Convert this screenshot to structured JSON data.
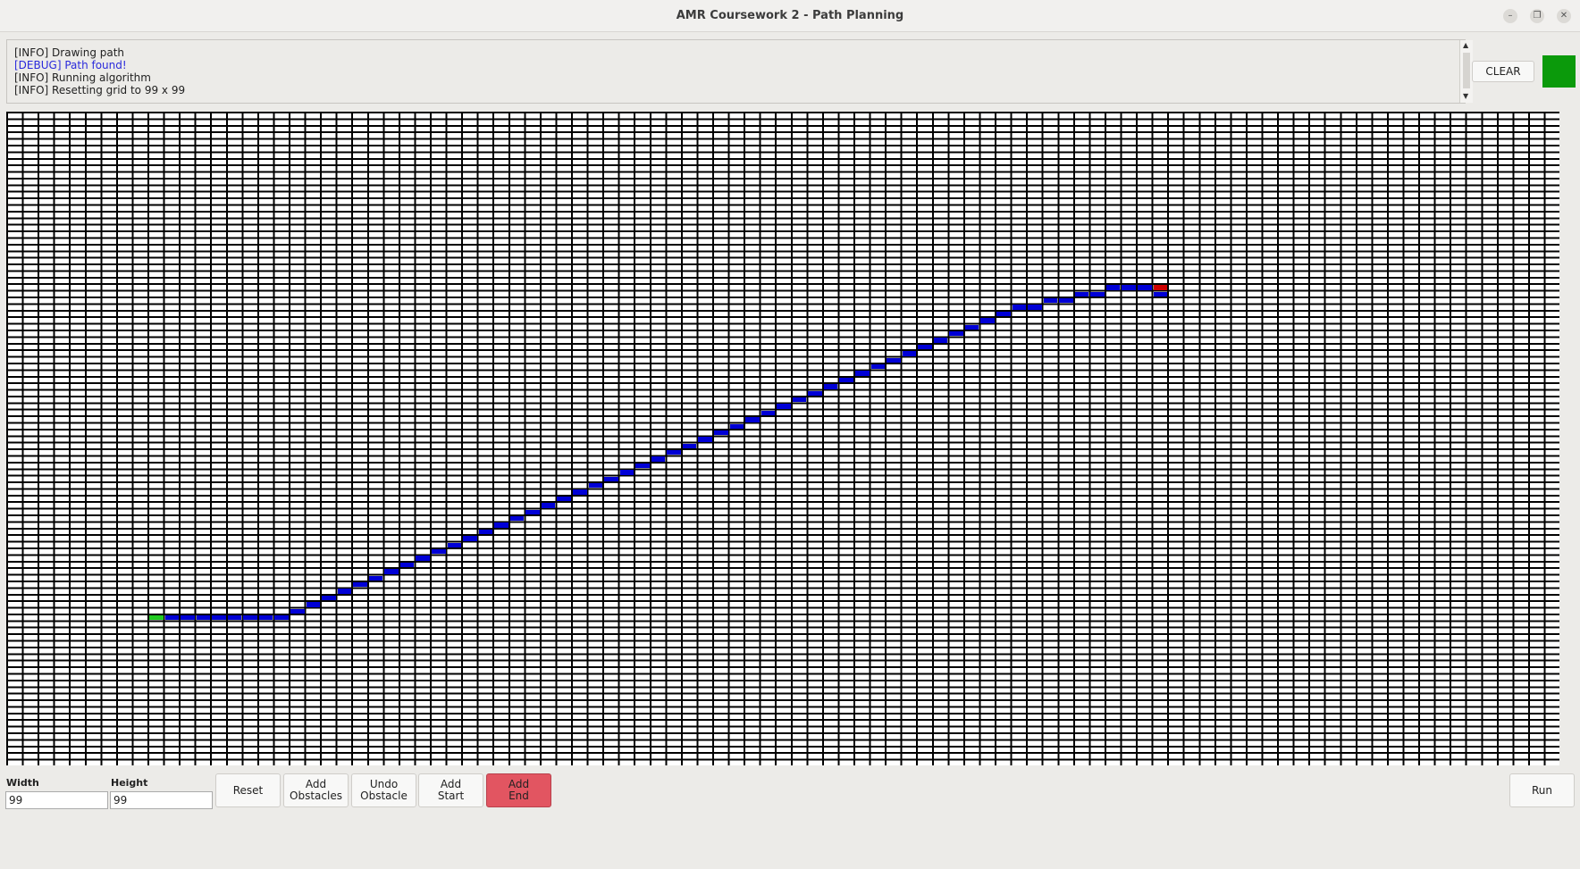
{
  "window": {
    "title": "AMR Coursework 2 - Path Planning",
    "controls": [
      {
        "name": "minimize-icon",
        "glyph": "–"
      },
      {
        "name": "maximize-icon",
        "glyph": "❐"
      },
      {
        "name": "close-icon",
        "glyph": "✕"
      }
    ]
  },
  "log": {
    "lines": [
      {
        "text": "[INFO] Drawing path",
        "level": "info"
      },
      {
        "text": "[DEBUG] Path found!",
        "level": "debug"
      },
      {
        "text": "[INFO] Running algorithm",
        "level": "info"
      },
      {
        "text": "[INFO] Resetting grid to 99 x 99",
        "level": "info"
      }
    ]
  },
  "toolbar_top": {
    "clear_label": "CLEAR",
    "status_color": "#0b9a0b"
  },
  "grid": {
    "columns": 99,
    "rows": 99,
    "colors": {
      "path": "#0000d6",
      "start": "#22cc22",
      "end": "#cc0000",
      "line": "#000000",
      "empty": "#ffffff"
    },
    "start": {
      "col": 9,
      "row": 76
    },
    "end": {
      "col": 73,
      "row": 26
    },
    "path": [
      [
        10,
        76
      ],
      [
        11,
        76
      ],
      [
        12,
        76
      ],
      [
        13,
        76
      ],
      [
        14,
        76
      ],
      [
        15,
        76
      ],
      [
        16,
        76
      ],
      [
        17,
        76
      ],
      [
        18,
        75
      ],
      [
        19,
        74
      ],
      [
        20,
        73
      ],
      [
        21,
        72
      ],
      [
        22,
        71
      ],
      [
        23,
        70
      ],
      [
        24,
        69
      ],
      [
        25,
        68
      ],
      [
        26,
        67
      ],
      [
        27,
        66
      ],
      [
        28,
        65
      ],
      [
        29,
        64
      ],
      [
        30,
        63
      ],
      [
        31,
        62
      ],
      [
        32,
        61
      ],
      [
        33,
        60
      ],
      [
        34,
        59
      ],
      [
        35,
        58
      ],
      [
        36,
        57
      ],
      [
        37,
        56
      ],
      [
        38,
        55
      ],
      [
        39,
        54
      ],
      [
        40,
        53
      ],
      [
        41,
        52
      ],
      [
        42,
        51
      ],
      [
        43,
        50
      ],
      [
        44,
        49
      ],
      [
        45,
        48
      ],
      [
        46,
        47
      ],
      [
        47,
        46
      ],
      [
        48,
        45
      ],
      [
        49,
        44
      ],
      [
        50,
        43
      ],
      [
        51,
        42
      ],
      [
        52,
        41
      ],
      [
        53,
        40
      ],
      [
        54,
        39
      ],
      [
        55,
        38
      ],
      [
        56,
        37
      ],
      [
        57,
        36
      ],
      [
        58,
        35
      ],
      [
        59,
        34
      ],
      [
        60,
        33
      ],
      [
        61,
        32
      ],
      [
        62,
        31
      ],
      [
        63,
        30
      ],
      [
        64,
        29
      ],
      [
        65,
        29
      ],
      [
        66,
        28
      ],
      [
        67,
        28
      ],
      [
        68,
        27
      ],
      [
        69,
        27
      ],
      [
        70,
        26
      ],
      [
        71,
        26
      ],
      [
        72,
        26
      ],
      [
        73,
        27
      ]
    ]
  },
  "controls": {
    "width_label": "Width",
    "width_value": "99",
    "height_label": "Height",
    "height_value": "99",
    "reset_label": "Reset",
    "add_obstacles_label": "Add\nObstacles",
    "undo_obstacle_label": "Undo\nObstacle",
    "add_start_label": "Add\nStart",
    "add_end_label": "Add\nEnd",
    "run_label": "Run"
  }
}
